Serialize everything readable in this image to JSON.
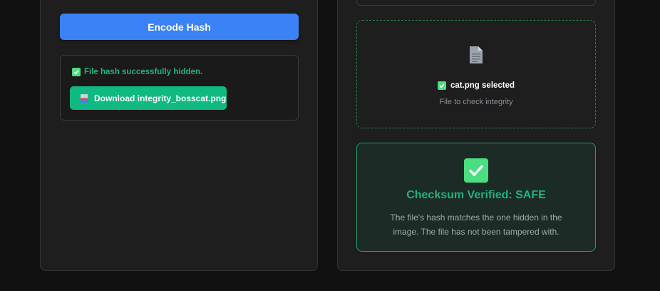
{
  "left_panel": {
    "encode_button_label": "Encode Hash",
    "result": {
      "status_icon": "check-square-icon",
      "status_text": "File hash successfully hidden.",
      "download_icon": "image-file-icon",
      "download_label": "Download integrity_bosscat.png"
    }
  },
  "right_panel": {
    "dropzone": {
      "file_icon": "document-icon",
      "selected_icon": "check-square-icon",
      "selected_text": "cat.png selected",
      "hint": "File to check integrity"
    },
    "verification": {
      "icon": "check-square-icon",
      "title": "Checksum Verified: SAFE",
      "description": "The file's hash matches the one hidden in the image. The file has not been tampered with."
    }
  },
  "colors": {
    "background": "#111111",
    "panel": "#1e1e1e",
    "primary_button": "#3b82f6",
    "success_button": "#10b981",
    "success_text": "#22b07d",
    "check_green": "#4ade80"
  }
}
